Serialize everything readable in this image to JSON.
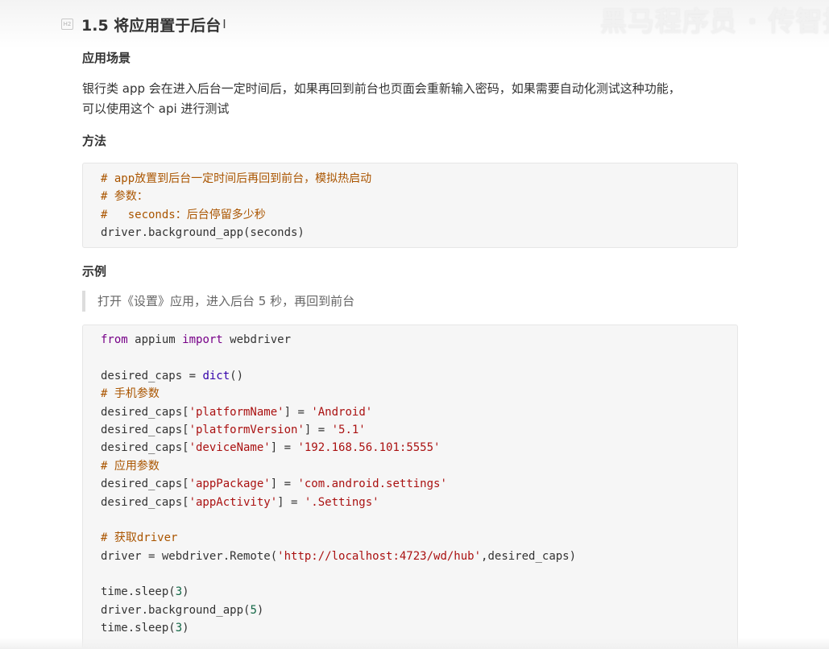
{
  "watermark": "黑马程序员 · 传智播客",
  "section": {
    "heading_marker": "H2",
    "title": "1.5 将应用置于后台",
    "cursor_glyph": "I"
  },
  "use_case": {
    "heading": "应用场景",
    "lines": [
      "银行类 app 会在进入后台一定时间后，如果再回到前台也页面会重新输入密码，如果需要自动化测试这种功能，",
      "可以使用这个 api 进行测试"
    ]
  },
  "method": {
    "heading": "方法",
    "code": [
      [
        {
          "t": "# app放置到后台一定时间后再回到前台，模拟热启动",
          "c": "comment"
        }
      ],
      [
        {
          "t": "# 参数：",
          "c": "comment"
        }
      ],
      [
        {
          "t": "#   seconds：后台停留多少秒",
          "c": "comment"
        }
      ],
      [
        {
          "t": "driver.background_app(seconds)",
          "c": ""
        }
      ]
    ]
  },
  "example": {
    "heading": "示例",
    "quote": "打开《设置》应用，进入后台 5 秒，再回到前台",
    "code": [
      [
        {
          "t": "from",
          "c": "keyword"
        },
        {
          "t": " appium ",
          "c": ""
        },
        {
          "t": "import",
          "c": "keyword"
        },
        {
          "t": " webdriver",
          "c": ""
        }
      ],
      [],
      [
        {
          "t": "desired_caps = ",
          "c": ""
        },
        {
          "t": "dict",
          "c": "builtin"
        },
        {
          "t": "()",
          "c": ""
        }
      ],
      [
        {
          "t": "# 手机参数",
          "c": "comment"
        }
      ],
      [
        {
          "t": "desired_caps[",
          "c": ""
        },
        {
          "t": "'platformName'",
          "c": "string"
        },
        {
          "t": "] = ",
          "c": ""
        },
        {
          "t": "'Android'",
          "c": "string"
        }
      ],
      [
        {
          "t": "desired_caps[",
          "c": ""
        },
        {
          "t": "'platformVersion'",
          "c": "string"
        },
        {
          "t": "] = ",
          "c": ""
        },
        {
          "t": "'5.1'",
          "c": "string"
        }
      ],
      [
        {
          "t": "desired_caps[",
          "c": ""
        },
        {
          "t": "'deviceName'",
          "c": "string"
        },
        {
          "t": "] = ",
          "c": ""
        },
        {
          "t": "'192.168.56.101:5555'",
          "c": "string"
        }
      ],
      [
        {
          "t": "# 应用参数",
          "c": "comment"
        }
      ],
      [
        {
          "t": "desired_caps[",
          "c": ""
        },
        {
          "t": "'appPackage'",
          "c": "string"
        },
        {
          "t": "] = ",
          "c": ""
        },
        {
          "t": "'com.android.settings'",
          "c": "string"
        }
      ],
      [
        {
          "t": "desired_caps[",
          "c": ""
        },
        {
          "t": "'appActivity'",
          "c": "string"
        },
        {
          "t": "] = ",
          "c": ""
        },
        {
          "t": "'.Settings'",
          "c": "string"
        }
      ],
      [],
      [
        {
          "t": "# 获取driver",
          "c": "comment"
        }
      ],
      [
        {
          "t": "driver = webdriver.Remote(",
          "c": ""
        },
        {
          "t": "'http://localhost:4723/wd/hub'",
          "c": "string"
        },
        {
          "t": ",desired_caps)",
          "c": ""
        }
      ],
      [],
      [
        {
          "t": "time.sleep(",
          "c": ""
        },
        {
          "t": "3",
          "c": "number"
        },
        {
          "t": ")",
          "c": ""
        }
      ],
      [
        {
          "t": "driver.background_app(",
          "c": ""
        },
        {
          "t": "5",
          "c": "number"
        },
        {
          "t": ")",
          "c": ""
        }
      ],
      [
        {
          "t": "time.sleep(",
          "c": ""
        },
        {
          "t": "3",
          "c": "number"
        },
        {
          "t": ")",
          "c": ""
        }
      ]
    ]
  },
  "colors": {
    "comment": "#aa5500",
    "keyword": "#770088",
    "string": "#aa1111",
    "builtin": "#3300aa",
    "number": "#116644",
    "code_background": "#f6f6f6"
  }
}
